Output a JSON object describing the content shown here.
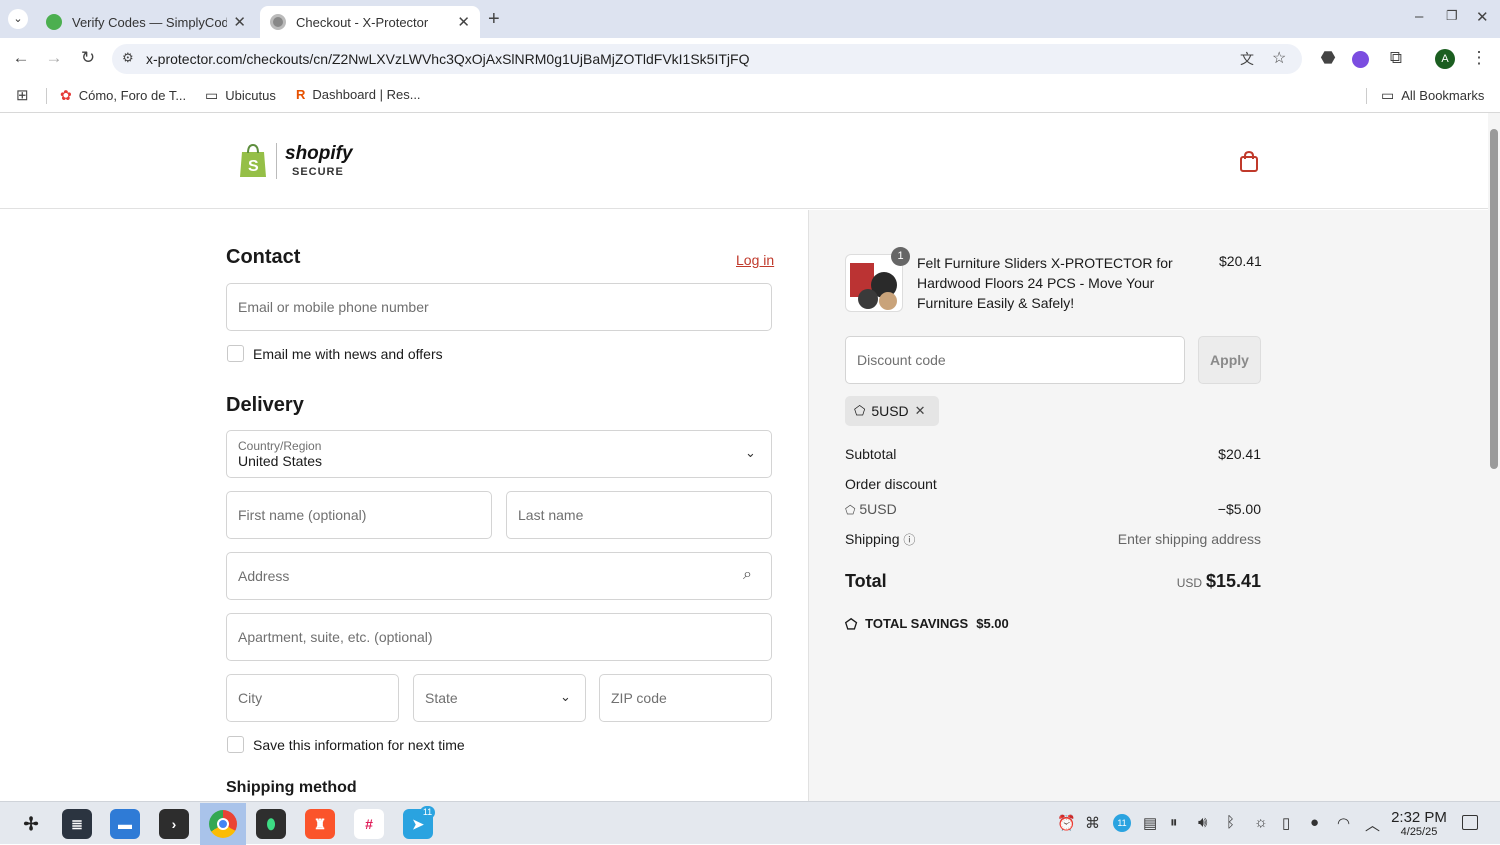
{
  "browser": {
    "tabs": [
      {
        "title": "Verify Codes — SimplyCodes",
        "active": false
      },
      {
        "title": "Checkout - X-Protector",
        "active": true
      }
    ],
    "new_tab": "+",
    "url": "x-protector.com/checkouts/cn/Z2NwLXVzLWVhc3QxOjAxSlNRM0g1UjBaMjZOTldFVkI1Sk5ITjFQ",
    "bookmarks": [
      "Cómo, Foro de T...",
      "Ubicutus",
      "Dashboard | Res..."
    ],
    "all_bookmarks": "All Bookmarks",
    "profile_initial": "A"
  },
  "header": {
    "logo_text": "shopify",
    "logo_sub": "SECURE"
  },
  "contact": {
    "heading": "Contact",
    "login": "Log in",
    "email_placeholder": "Email or mobile phone number",
    "news_label": "Email me with news and offers"
  },
  "delivery": {
    "heading": "Delivery",
    "country_label": "Country/Region",
    "country_value": "United States",
    "first_name": "First name (optional)",
    "last_name": "Last name",
    "address": "Address",
    "apartment": "Apartment, suite, etc. (optional)",
    "city": "City",
    "state": "State",
    "zip": "ZIP code",
    "save_label": "Save this information for next time"
  },
  "shipping_method_heading": "Shipping method",
  "summary": {
    "product_name": "Felt Furniture Sliders X-PROTECTOR for Hardwood Floors 24 PCS - Move Your Furniture Easily & Safely!",
    "product_qty": "1",
    "product_price": "$20.41",
    "discount_placeholder": "Discount code",
    "apply": "Apply",
    "applied_code": "5USD",
    "subtotal_label": "Subtotal",
    "subtotal_value": "$20.41",
    "order_discount_label": "Order discount",
    "discount_code": "5USD",
    "discount_value": "−$5.00",
    "shipping_label": "Shipping",
    "shipping_value": "Enter shipping address",
    "total_label": "Total",
    "currency": "USD",
    "total_value": "$15.41",
    "savings_label": "TOTAL SAVINGS",
    "savings_value": "$5.00"
  },
  "taskbar": {
    "telegram_badge": "11",
    "tray_badge": "11",
    "time": "2:32 PM",
    "date": "4/25/25"
  },
  "colors": {
    "link": "#c0392b",
    "tabbar": "#dde3f0",
    "summary_bg": "#f5f5f5",
    "shopify_green": "#95bf47"
  }
}
